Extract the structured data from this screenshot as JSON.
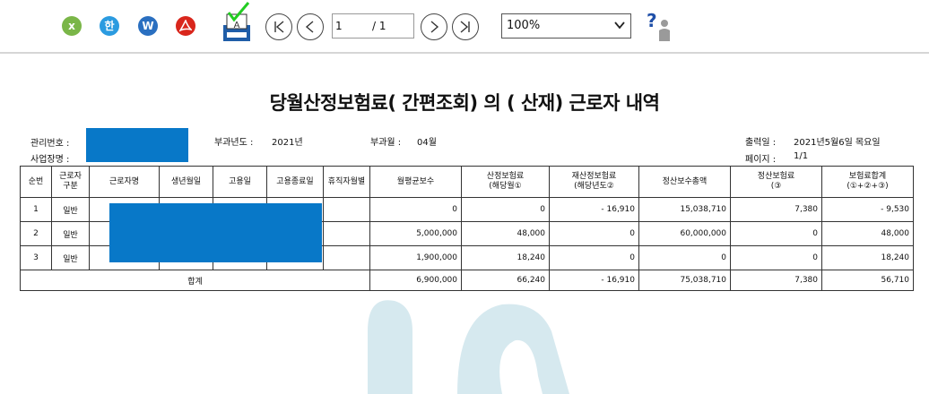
{
  "toolbar": {
    "export_icons": [
      {
        "name": "excel-export-icon",
        "glyph": "x"
      },
      {
        "name": "hwp-export-icon",
        "glyph": "한"
      },
      {
        "name": "word-export-icon",
        "glyph": "W"
      },
      {
        "name": "pdf-export-icon",
        "glyph": ""
      }
    ],
    "page_current": "1",
    "page_total": "/ 1",
    "zoom_value": "100%"
  },
  "report": {
    "title": "당월산정보험료( 간편조회) 의 ( 산재) 근로자 내역",
    "mgmt_no_label": "관리번호 :",
    "site_name_label": "사업장명 :",
    "levy_year_label": "부과년도 :",
    "levy_year": "2021년",
    "levy_month_label": "부과월 :",
    "levy_month": "04월",
    "print_date_label": "출력일 :",
    "print_date": "2021년5월6일 목요일",
    "page_label": "페이지 :",
    "page_value": "1/1"
  },
  "table": {
    "headers": [
      "순번",
      "근로자\n구분",
      "근로자명",
      "생년월일",
      "고용일",
      "고용종료일",
      "휴직자월별",
      "월평균보수",
      "산정보험료\n(해당월①",
      "재산정보험료\n(해당년도②",
      "정산보수총액",
      "정산보험료\n(③",
      "보험료합계\n(①+②+③)"
    ],
    "rows": [
      {
        "no": "1",
        "type": "일반",
        "pay": "0",
        "prem": "0",
        "reprem": "- 16,910",
        "settle_total": "15,038,710",
        "settle_prem": "7,380",
        "sum": "- 9,530"
      },
      {
        "no": "2",
        "type": "일반",
        "pay": "5,000,000",
        "prem": "48,000",
        "reprem": "0",
        "settle_total": "60,000,000",
        "settle_prem": "0",
        "sum": "48,000"
      },
      {
        "no": "3",
        "type": "일반",
        "pay": "1,900,000",
        "prem": "18,240",
        "reprem": "0",
        "settle_total": "0",
        "settle_prem": "0",
        "sum": "18,240"
      }
    ],
    "total": {
      "label": "합계",
      "pay": "6,900,000",
      "prem": "66,240",
      "reprem": "- 16,910",
      "settle_total": "75,038,710",
      "settle_prem": "7,380",
      "sum": "56,710"
    }
  },
  "colors": {
    "mask": "#0878c8",
    "check": "#22cc22",
    "watermark": "#d6e9ef"
  }
}
